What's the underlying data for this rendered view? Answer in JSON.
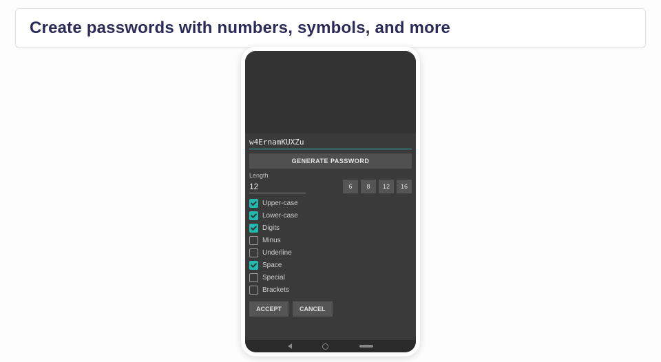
{
  "caption": "Create passwords with numbers, symbols, and more",
  "generator": {
    "password_value": "w4ErnamKUXZu",
    "generate_button": "GENERATE PASSWORD",
    "length_label": "Length",
    "length_value": "12",
    "length_presets": [
      "6",
      "8",
      "12",
      "16"
    ],
    "options": [
      {
        "label": "Upper-case",
        "checked": true
      },
      {
        "label": "Lower-case",
        "checked": true
      },
      {
        "label": "Digits",
        "checked": true
      },
      {
        "label": "Minus",
        "checked": false
      },
      {
        "label": "Underline",
        "checked": false
      },
      {
        "label": "Space",
        "checked": true
      },
      {
        "label": "Special",
        "checked": false
      },
      {
        "label": "Brackets",
        "checked": false
      }
    ],
    "accept_button": "ACCEPT",
    "cancel_button": "CANCEL"
  }
}
